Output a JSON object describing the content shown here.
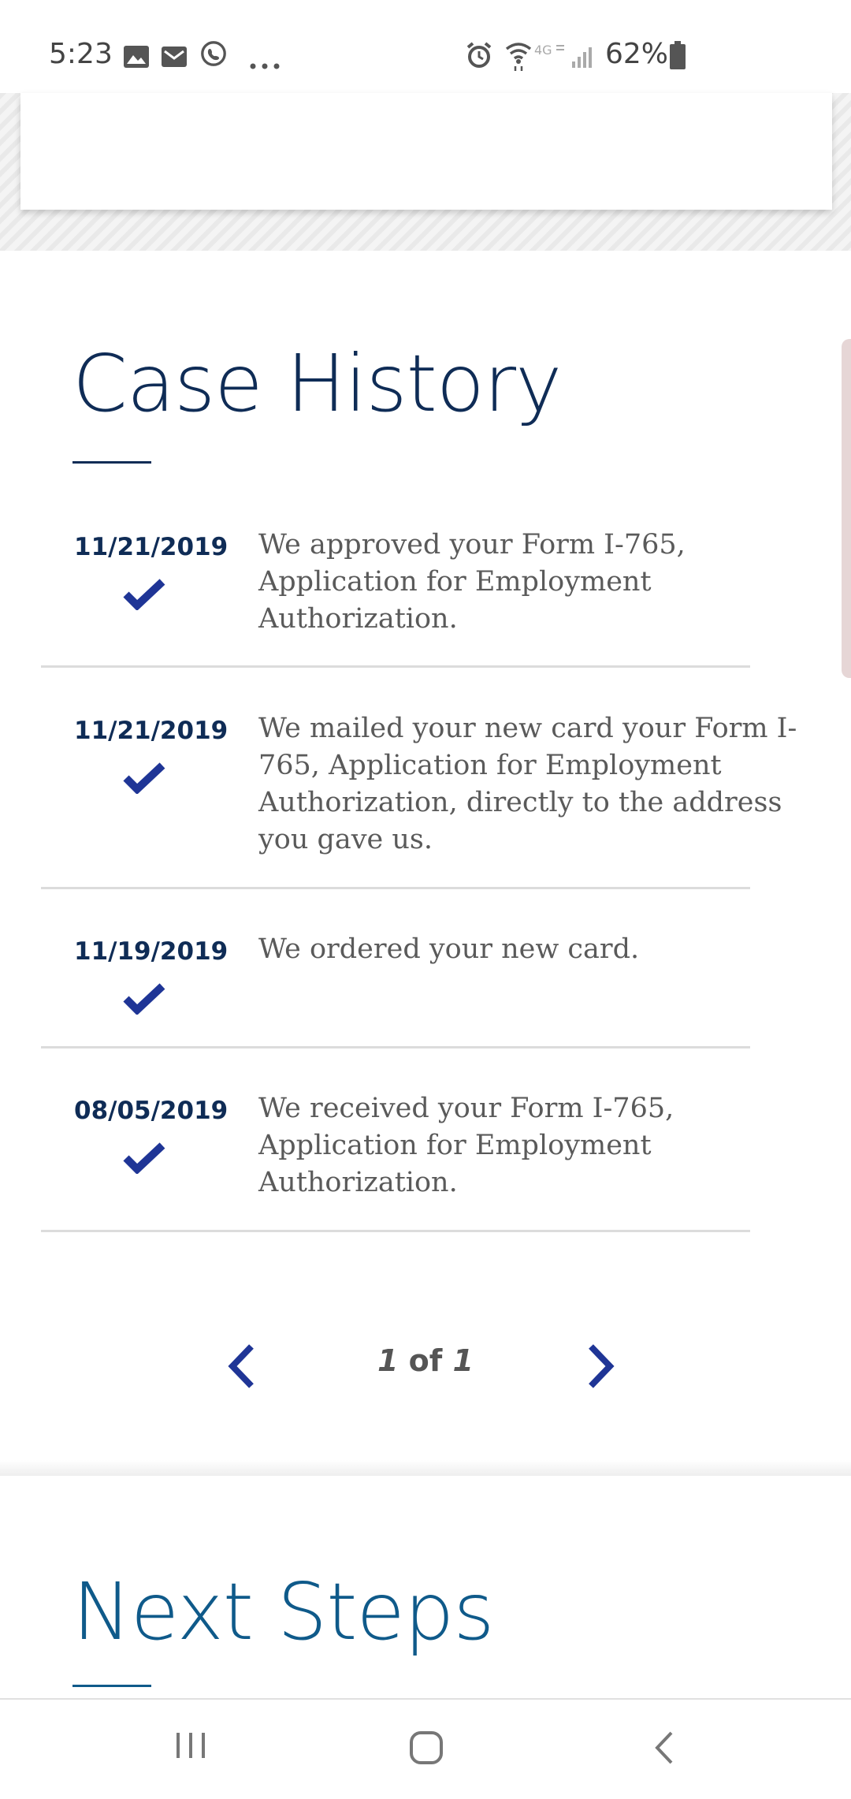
{
  "status_bar": {
    "time": "5:23",
    "battery_percent": "62%",
    "icons": [
      "image-icon",
      "mail-icon",
      "whatsapp-icon",
      "more-icon",
      "alarm-icon",
      "wifi-icon",
      "4g-icon",
      "signal-icon",
      "battery-icon"
    ]
  },
  "case_history": {
    "title": "Case History",
    "entries": [
      {
        "date": "11/21/2019",
        "text": "We approved your Form I-765, Application for Employment Authorization."
      },
      {
        "date": "11/21/2019",
        "text": "We mailed your new card your Form I-765, Application for Employment Authorization, directly to the address you gave us."
      },
      {
        "date": "11/19/2019",
        "text": "We ordered your new card."
      },
      {
        "date": "08/05/2019",
        "text": "We received your Form I-765, Application for Employment Authorization."
      }
    ],
    "pagination": {
      "current": "1",
      "of_label": "of",
      "total": "1"
    }
  },
  "next_steps": {
    "title": "Next Steps"
  },
  "colors": {
    "heading": "#0f2c56",
    "next_steps_heading": "#0f5a8a",
    "check": "#1f3596",
    "body_text": "#5a5a5a"
  }
}
